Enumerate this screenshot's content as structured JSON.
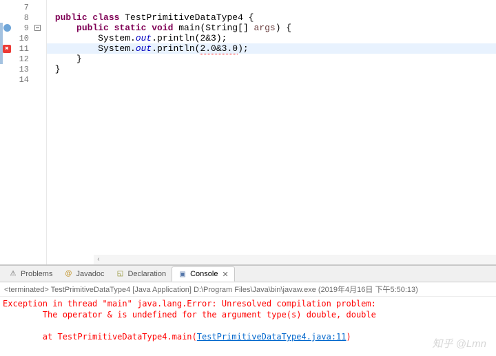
{
  "editor": {
    "lines": [
      {
        "num": 7,
        "marker": null,
        "blueBar": false,
        "fold": false,
        "tokens": []
      },
      {
        "num": 8,
        "marker": null,
        "blueBar": false,
        "fold": false,
        "tokens": [
          {
            "t": " ",
            "c": ""
          },
          {
            "t": "public class",
            "c": "kw"
          },
          {
            "t": " TestPrimitiveDataType4 {",
            "c": ""
          }
        ]
      },
      {
        "num": 9,
        "marker": "override",
        "blueBar": true,
        "fold": true,
        "tokens": [
          {
            "t": "     ",
            "c": ""
          },
          {
            "t": "public static void",
            "c": "kw"
          },
          {
            "t": " main(String[] ",
            "c": ""
          },
          {
            "t": "args",
            "c": "args"
          },
          {
            "t": ") {",
            "c": ""
          }
        ]
      },
      {
        "num": 10,
        "marker": null,
        "blueBar": true,
        "fold": false,
        "tokens": [
          {
            "t": "         System.",
            "c": ""
          },
          {
            "t": "out",
            "c": "ital"
          },
          {
            "t": ".println(2&3);",
            "c": ""
          }
        ]
      },
      {
        "num": 11,
        "marker": "error",
        "blueBar": true,
        "fold": false,
        "highlight": true,
        "tokens": [
          {
            "t": "         System.",
            "c": ""
          },
          {
            "t": "out",
            "c": "ital"
          },
          {
            "t": ".println(",
            "c": ""
          },
          {
            "t": "2.0&3.0",
            "c": "err"
          },
          {
            "t": ");",
            "c": ""
          }
        ]
      },
      {
        "num": 12,
        "marker": null,
        "blueBar": true,
        "fold": false,
        "tokens": [
          {
            "t": "     }",
            "c": ""
          }
        ]
      },
      {
        "num": 13,
        "marker": null,
        "blueBar": false,
        "fold": false,
        "tokens": [
          {
            "t": " }",
            "c": ""
          }
        ]
      },
      {
        "num": 14,
        "marker": null,
        "blueBar": false,
        "fold": false,
        "tokens": []
      }
    ]
  },
  "tabs": {
    "problems": "Problems",
    "javadoc": "Javadoc",
    "declaration": "Declaration",
    "console": "Console"
  },
  "console": {
    "header_prefix": "<terminated> TestPrimitiveDataType4 [Java Application] D:\\Program Files\\Java\\bin\\javaw.exe (2019年4月16日 下午5:50:13)",
    "line1": "Exception in thread \"main\" java.lang.Error: Unresolved compilation problem: ",
    "line2": "        The operator & is undefined for the argument type(s) double, double",
    "line3_pre": "        at TestPrimitiveDataType4.main(",
    "line3_link": "TestPrimitiveDataType4.java:11",
    "line3_post": ")"
  },
  "watermark": "知乎 @Lmn"
}
